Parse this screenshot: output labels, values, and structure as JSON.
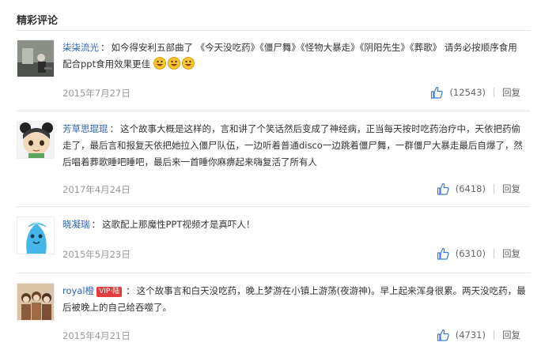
{
  "section": {
    "title": "精彩评论"
  },
  "comments": [
    {
      "username": "柒柒流光",
      "vip_badge": "",
      "separator": "：",
      "text": "如今得安利五部曲了 《今天没吃药》《僵尸舞》《怪物大暴走》《阴阳先生》《葬歌》 请务必按顺序食用 配合ppt食用效果更佳",
      "emoji_icons": [
        "smile-emoji-icon",
        "smile-emoji-icon",
        "smile-emoji-icon"
      ],
      "date": "2015年7月27日",
      "likes": "(12543)",
      "reply_label": "回复"
    },
    {
      "username": "芳草思琨琨",
      "vip_badge": "",
      "separator": "：",
      "text": "这个故事大概是这样的，言和讲了个笑话然后变成了神经病，正当每天按时吃药治疗中，天依把药偷走了，最后言和报复天依把她拉入僵尸队伍，一边听着普通disco一边跳着僵尸舞，一群僵尸大暴走最后自爆了，然后唱着葬歌睡吧睡吧，最后来一首睡你麻痹起来嗨复活了所有人",
      "date": "2017年4月24日",
      "likes": "(6418)",
      "reply_label": "回复"
    },
    {
      "username": "晓凝瑞",
      "vip_badge": "",
      "separator": "：",
      "text": "这歌配上那魔性PPT视频才是真吓人！",
      "date": "2015年5月23日",
      "likes": "(6310)",
      "reply_label": "回复"
    },
    {
      "username": "royal橙",
      "vip_badge": "VIP·陆",
      "separator": "：",
      "text": "这个故事言和白天没吃药，晚上梦游在小镇上游荡(夜游神)。早上起来浑身很累。两天没吃药，最后被晚上的自己给吞噬了。",
      "date": "2015年4月21日",
      "likes": "(4731)",
      "reply_label": "回复"
    }
  ],
  "colors": {
    "username": "#2d64b3",
    "date": "#999999",
    "vip": "#e23d3d",
    "thumb": "#3a7bd5"
  }
}
